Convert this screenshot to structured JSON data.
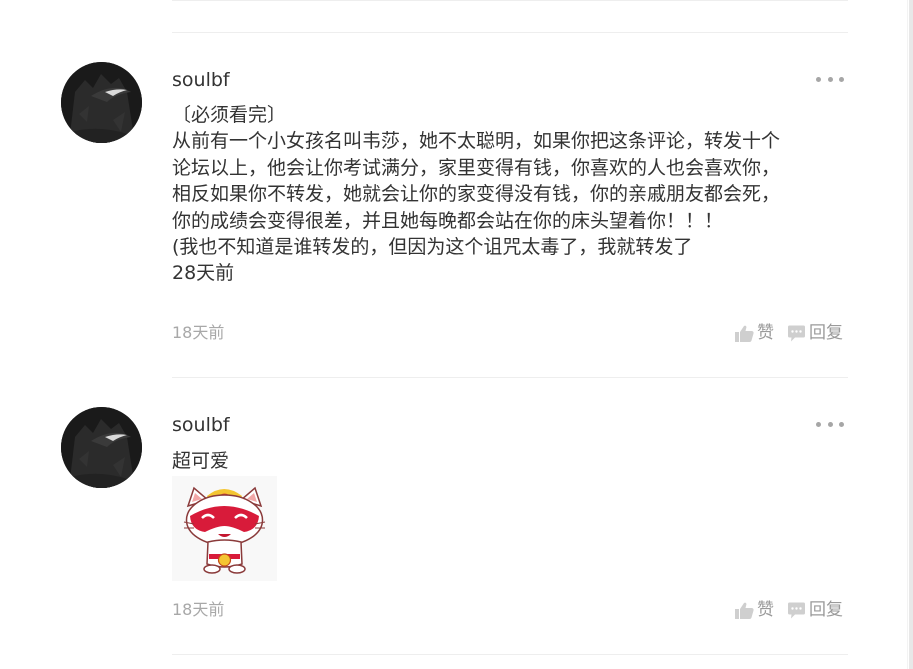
{
  "comments": [
    {
      "username": "soulbf",
      "lines": [
        "〔必须看完〕",
        "从前有一个小女孩名叫韦莎，她不太聪明，如果你把这条评论，转发十个",
        "论坛以上，他会让你考试满分，家里变得有钱，你喜欢的人也会喜欢你，",
        "相反如果你不转发，她就会让你的家变得没有钱，你的亲戚朋友都会死，",
        "你的成绩会变得很差，并且她每晚都会站在你的床头望着你！！！",
        "(我也不知道是谁转发的，但因为这个诅咒太毒了，我就转发了",
        "28天前"
      ],
      "time": "18天前",
      "like_label": "赞",
      "reply_label": "回复"
    },
    {
      "username": "soulbf",
      "lines": [
        "超可爱"
      ],
      "time": "18天前",
      "like_label": "赞",
      "reply_label": "回复"
    }
  ],
  "colors": {
    "text": "#333333",
    "muted": "#a8a8a8",
    "action": "#9a9a9a",
    "divider": "#eeeeee",
    "sticker_red": "#d81b3a",
    "sticker_yellow": "#f4c531"
  },
  "icons": {
    "more": "more-dots-icon",
    "like": "thumbs-up-icon",
    "reply": "speech-bubble-icon"
  }
}
